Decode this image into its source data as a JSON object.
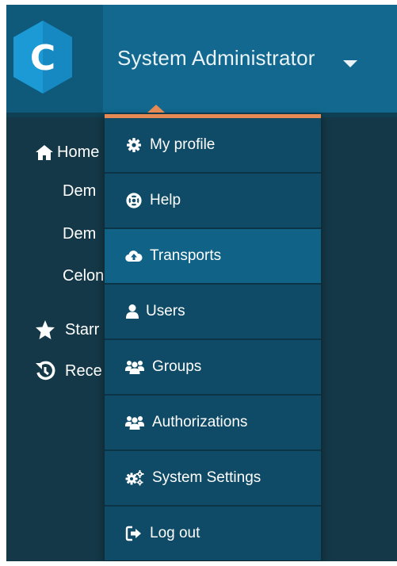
{
  "header": {
    "logo_letter": "C",
    "user_name": "System Administrator",
    "user_caret_icon": "caret-down-icon"
  },
  "sidebar": {
    "items": [
      {
        "label": "Home",
        "icon": "home-icon"
      },
      {
        "label": "Dem"
      },
      {
        "label": "Dem"
      },
      {
        "label": "Celon"
      },
      {
        "label": "Starr",
        "icon": "star-icon"
      },
      {
        "label": "Rece",
        "icon": "history-icon"
      }
    ]
  },
  "user_dropdown": {
    "items": [
      {
        "label": "My profile",
        "icon": "gear-icon"
      },
      {
        "label": "Help",
        "icon": "lifebuoy-icon"
      },
      {
        "label": "Transports",
        "icon": "cloud-upload-icon",
        "active": true
      },
      {
        "label": "Users",
        "icon": "user-icon"
      },
      {
        "label": "Groups",
        "icon": "group-icon"
      },
      {
        "label": "Authorizations",
        "icon": "group-icon"
      },
      {
        "label": "System Settings",
        "icon": "gears-icon"
      },
      {
        "label": "Log out",
        "icon": "sign-out-icon"
      }
    ]
  },
  "colors": {
    "header_bg": "#12688e",
    "sidebar_bg": "#143847",
    "accent": "#e58a54",
    "dropdown_bg": "#0f4b66",
    "dropdown_active_bg": "#106387"
  }
}
